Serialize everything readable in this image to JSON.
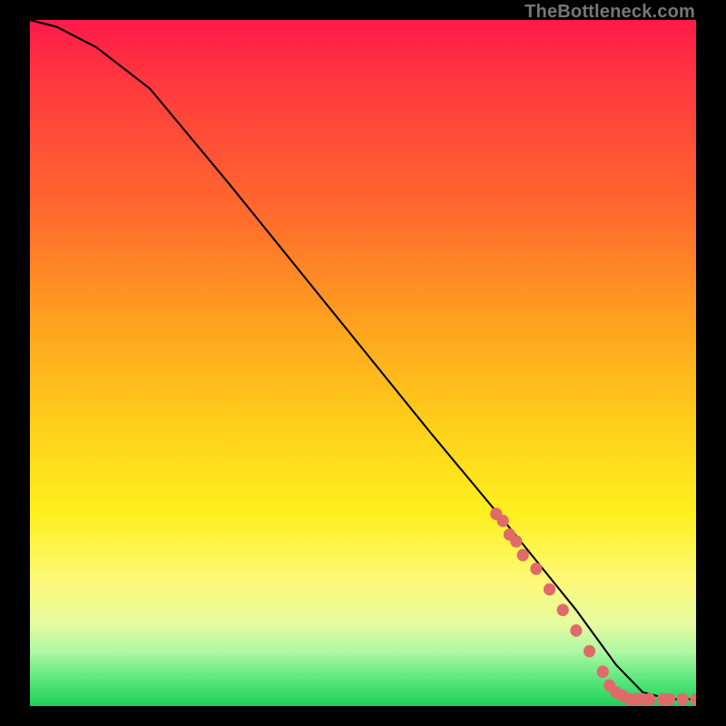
{
  "attribution": "TheBottleneck.com",
  "chart_data": {
    "type": "line",
    "title": "",
    "xlabel": "",
    "ylabel": "",
    "xlim": [
      0,
      100
    ],
    "ylim": [
      0,
      100
    ],
    "series": [
      {
        "name": "curve",
        "x": [
          0,
          4,
          10,
          18,
          30,
          45,
          60,
          72,
          82,
          88,
          92,
          96,
          100
        ],
        "y": [
          100,
          99,
          96,
          90,
          76,
          58,
          40,
          26,
          14,
          6,
          2,
          1,
          1
        ]
      }
    ],
    "markers": {
      "name": "highlighted-points",
      "color": "#e06a6a",
      "points": [
        {
          "x": 70,
          "y": 28
        },
        {
          "x": 71,
          "y": 27
        },
        {
          "x": 72,
          "y": 25
        },
        {
          "x": 73,
          "y": 24
        },
        {
          "x": 74,
          "y": 22
        },
        {
          "x": 76,
          "y": 20
        },
        {
          "x": 78,
          "y": 17
        },
        {
          "x": 80,
          "y": 14
        },
        {
          "x": 82,
          "y": 11
        },
        {
          "x": 84,
          "y": 8
        },
        {
          "x": 86,
          "y": 5
        },
        {
          "x": 87,
          "y": 3
        },
        {
          "x": 88,
          "y": 2
        },
        {
          "x": 89,
          "y": 1.5
        },
        {
          "x": 90,
          "y": 1
        },
        {
          "x": 91,
          "y": 1
        },
        {
          "x": 92,
          "y": 1
        },
        {
          "x": 93,
          "y": 1
        },
        {
          "x": 95,
          "y": 1
        },
        {
          "x": 96,
          "y": 1
        },
        {
          "x": 98,
          "y": 1
        },
        {
          "x": 100,
          "y": 1
        }
      ]
    },
    "background_gradient": {
      "top": "#ff1a49",
      "upper_mid": "#ff8a20",
      "mid": "#ffe01f",
      "lower_mid": "#e6fba0",
      "bottom": "#1ecf57"
    }
  }
}
